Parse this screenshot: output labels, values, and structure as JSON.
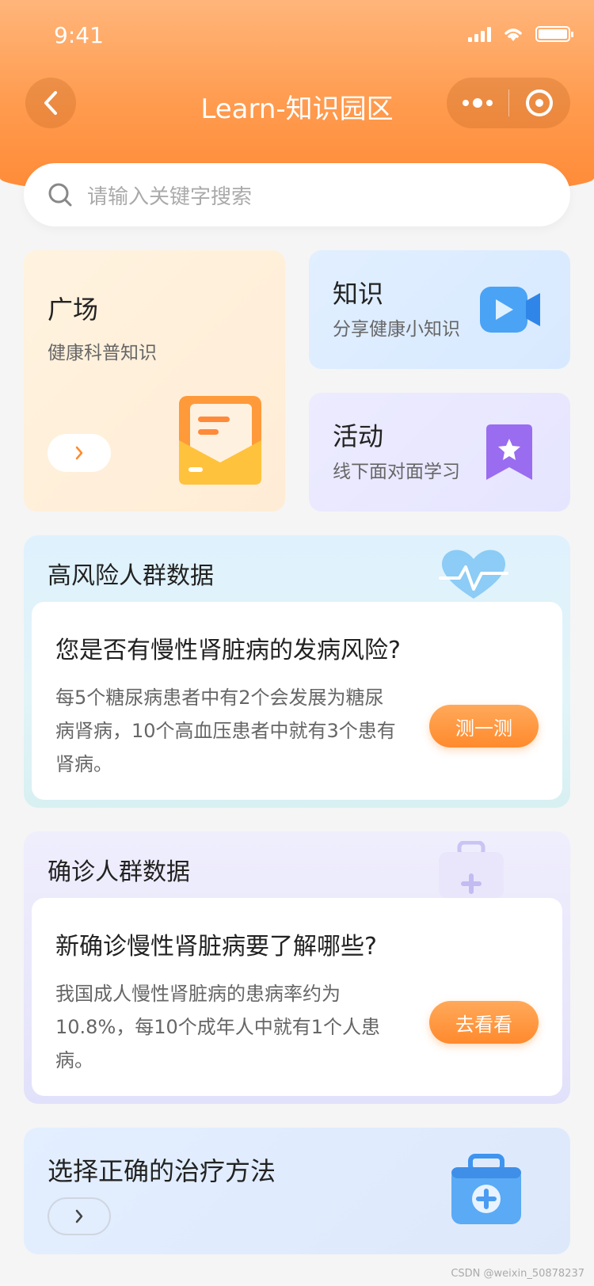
{
  "status": {
    "time": "9:41"
  },
  "nav": {
    "title": "Learn-知识园区"
  },
  "search": {
    "placeholder": "请输入关键字搜索"
  },
  "tiles": {
    "plaza": {
      "title": "广场",
      "subtitle": "健康科普知识"
    },
    "knowledge": {
      "title": "知识",
      "subtitle": "分享健康小知识"
    },
    "activity": {
      "title": "活动",
      "subtitle": "线下面对面学习"
    }
  },
  "risk": {
    "heading": "高风险人群数据",
    "question": "您是否有慢性肾脏病的发病风险?",
    "body": "每5个糖尿病患者中有2个会发展为糖尿病肾病，10个高血压患者中就有3个患有肾病。",
    "button": "测一测"
  },
  "diagnosed": {
    "heading": "确诊人群数据",
    "question": "新确诊慢性肾脏病要了解哪些?",
    "body": "我国成人慢性肾脏病的患病率约为10.8%，每10个成年人中就有1个人患病。",
    "button": "去看看"
  },
  "treatment": {
    "heading": "选择正确的治疗方法"
  },
  "watermark": "CSDN @weixin_50878237",
  "colors": {
    "accent": "#ff8a2d",
    "header": "#ff9a4d"
  }
}
